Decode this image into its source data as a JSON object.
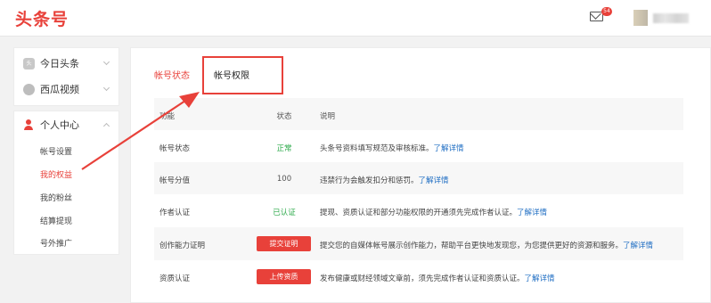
{
  "header": {
    "logo": "头条号",
    "mail_badge": "54"
  },
  "sidebar": {
    "top_items": [
      {
        "label": "今日头条",
        "icon": "toutiao-icon"
      },
      {
        "label": "西瓜视频",
        "icon": "xigua-icon"
      }
    ],
    "section": {
      "label": "个人中心",
      "items": [
        {
          "label": "帐号设置",
          "active": false
        },
        {
          "label": "我的权益",
          "active": true
        },
        {
          "label": "我的粉丝",
          "active": false
        },
        {
          "label": "结算提现",
          "active": false
        },
        {
          "label": "号外推广",
          "active": false
        }
      ]
    }
  },
  "tabs": [
    {
      "label": "帐号状态",
      "active": false
    },
    {
      "label": "帐号权限",
      "active": true
    }
  ],
  "table": {
    "headers": [
      "功能",
      "状态",
      "说明"
    ],
    "rows": [
      {
        "name": "帐号状态",
        "status": "正常",
        "desc": "头条号资料填写规范及审核标准。",
        "link": "了解详情"
      },
      {
        "name": "帐号分值",
        "status": "100",
        "desc": "违禁行为会触发扣分和惩罚。",
        "link": "了解详情"
      },
      {
        "name": "作者认证",
        "status": "已认证",
        "desc": "提现、资质认证和部分功能权限的开通须先完成作者认证。",
        "link": "了解详情"
      },
      {
        "name": "创作能力证明",
        "status": "提交证明",
        "desc": "提交您的自媒体帐号展示创作能力，帮助平台更快地发现您，为您提供更好的资源和服务。",
        "link": "了解详情"
      },
      {
        "name": "资质认证",
        "status": "上传资质",
        "desc": "发布健康或财经领域文章前，须先完成作者认证和资质认证。",
        "link": "了解详情"
      }
    ]
  },
  "colors": {
    "accent": "#e8413a",
    "status_ok": "#2daa4b",
    "link": "#1f6ec3"
  }
}
